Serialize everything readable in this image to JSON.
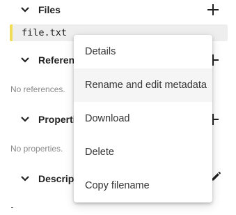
{
  "sections": {
    "files": {
      "title": "Files",
      "files": [
        {
          "name": "file.txt"
        }
      ]
    },
    "references": {
      "title": "References",
      "empty": "No references."
    },
    "properties": {
      "title": "Properties",
      "empty": "No properties."
    },
    "description": {
      "title": "Description"
    }
  },
  "context_menu": {
    "items": [
      {
        "label": "Details"
      },
      {
        "label": "Rename and edit metadata"
      },
      {
        "label": "Download"
      },
      {
        "label": "Delete"
      },
      {
        "label": "Copy filename"
      }
    ],
    "hovered_index": 1
  },
  "colors": {
    "file_marker": "#f2dd58",
    "menu_hover": "#f5f5f5",
    "empty_text": "#8a8a8a"
  },
  "icons": [
    "chevron-down-icon",
    "plus-icon",
    "pencil-icon"
  ]
}
